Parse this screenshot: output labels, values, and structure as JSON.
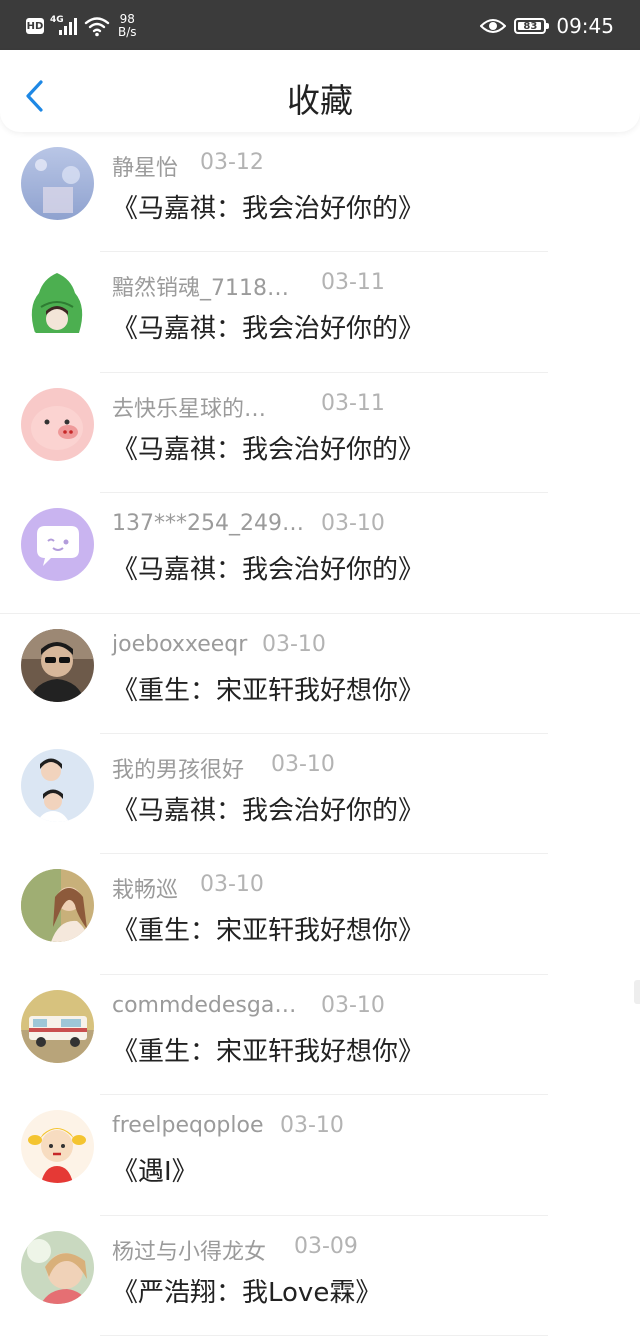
{
  "status_bar": {
    "hd": "HD",
    "network": "4G",
    "net_speed_value": "98",
    "net_speed_unit": "B/s",
    "battery_level": "83",
    "time": "09:45"
  },
  "header": {
    "back_icon": "chevron-left-icon",
    "title": "收藏",
    "accent_color": "#1e88e5"
  },
  "favorites": [
    {
      "user": "静星怡",
      "date": "03-12",
      "title": "《马嘉祺：我会治好你的》"
    },
    {
      "user": "黯然销魂_7118…",
      "date": "03-11",
      "title": "《马嘉祺：我会治好你的》"
    },
    {
      "user": "去快乐星球的…",
      "date": "03-11",
      "title": "《马嘉祺：我会治好你的》"
    },
    {
      "user": "137***254_249…",
      "date": "03-10",
      "title": "《马嘉祺：我会治好你的》"
    },
    {
      "user": "joeboxxeeqr",
      "date": "03-10",
      "title": "《重生：宋亚轩我好想你》"
    },
    {
      "user": "我的男孩很好",
      "date": "03-10",
      "title": "《马嘉祺：我会治好你的》"
    },
    {
      "user": "栽畅巡",
      "date": "03-10",
      "title": "《重生：宋亚轩我好想你》"
    },
    {
      "user": "commdedesga…",
      "date": "03-10",
      "title": "《重生：宋亚轩我好想你》"
    },
    {
      "user": "freelpeqoploe",
      "date": "03-10",
      "title": "《遇Ⅰ》"
    },
    {
      "user": "杨过与小得龙女",
      "date": "03-09",
      "title": "《严浩翔：我Love霖》"
    }
  ]
}
